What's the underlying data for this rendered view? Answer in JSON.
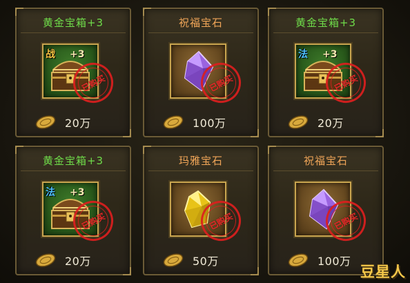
{
  "shop": {
    "items": [
      {
        "name": "黄金宝箱+3",
        "name_color": "#6fdc4a",
        "icon": "treasure-chest-icon",
        "slot_class": "",
        "corner_label": "战",
        "corner_color": "#f5c542",
        "plus_label": "+3",
        "status_stamp": "已购买",
        "price": "20万"
      },
      {
        "name": "祝福宝石",
        "name_color": "#f0a558",
        "icon": "purple-gem-icon",
        "corner_label": "",
        "plus_label": "",
        "status_stamp": "已购买",
        "price": "100万"
      },
      {
        "name": "黄金宝箱+3",
        "name_color": "#6fdc4a",
        "icon": "treasure-chest-icon",
        "corner_label": "法",
        "corner_color": "#4fc3ff",
        "plus_label": "+3",
        "status_stamp": "已购买",
        "price": "20万"
      },
      {
        "name": "黄金宝箱+3",
        "name_color": "#6fdc4a",
        "icon": "treasure-chest-icon",
        "corner_label": "法",
        "corner_color": "#4fc3ff",
        "plus_label": "+3",
        "status_stamp": "已购买",
        "price": "20万"
      },
      {
        "name": "玛雅宝石",
        "name_color": "#f0a558",
        "icon": "yellow-gem-icon",
        "corner_label": "",
        "plus_label": "",
        "status_stamp": "已购买",
        "price": "50万"
      },
      {
        "name": "祝福宝石",
        "name_color": "#f0a558",
        "icon": "purple-gem-icon",
        "corner_label": "",
        "plus_label": "",
        "status_stamp": "已购买",
        "price": "100万"
      }
    ]
  },
  "watermark": "豆星人",
  "colors": {
    "green_title": "#6fdc4a",
    "orange_title": "#f0a558",
    "stamp_red": "#e62828",
    "frame_gold": "#c9a54f",
    "panel_brown": "#2e2819"
  }
}
